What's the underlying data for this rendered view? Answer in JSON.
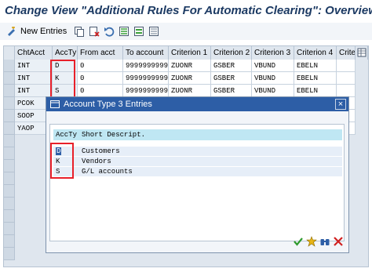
{
  "window": {
    "title": "Change View \"Additional Rules For Automatic Clearing\": Overview"
  },
  "toolbar": {
    "new_entries_label": "New Entries",
    "icons": [
      "new-entries-icon",
      "copy-icon",
      "delete-icon",
      "undo-icon",
      "select-all-icon",
      "select-block-icon",
      "deselect-all-icon"
    ]
  },
  "table": {
    "columns": [
      "ChtAcct",
      "AccTy",
      "From acct",
      "To account",
      "Criterion 1",
      "Criterion 2",
      "Criterion 3",
      "Criterion 4",
      "Crite"
    ],
    "rows": [
      {
        "chart": "INT",
        "acc_type": "D",
        "from": "0",
        "to": "9999999999",
        "c1": "ZUONR",
        "c2": "GSBER",
        "c3": "VBUND",
        "c4": "EBELN"
      },
      {
        "chart": "INT",
        "acc_type": "K",
        "from": "0",
        "to": "9999999999",
        "c1": "ZUONR",
        "c2": "GSBER",
        "c3": "VBUND",
        "c4": "EBELN"
      },
      {
        "chart": "INT",
        "acc_type": "S",
        "from": "0",
        "to": "9999999999",
        "c1": "ZUONR",
        "c2": "GSBER",
        "c3": "VBUND",
        "c4": "EBELN"
      },
      {
        "chart": "PCOK"
      },
      {
        "chart": "SOOP"
      },
      {
        "chart": "YAOP"
      }
    ]
  },
  "dialog": {
    "title": "Account Type 3 Entries",
    "close_label": "×",
    "headers": {
      "key": "AccTy",
      "desc": "Short Descript."
    },
    "items": [
      {
        "key": "D",
        "desc": "Customers"
      },
      {
        "key": "K",
        "desc": "Vendors"
      },
      {
        "key": "S",
        "desc": "G/L accounts"
      }
    ],
    "buttons": [
      "check-icon",
      "new-icon",
      "find-icon",
      "cancel-icon"
    ]
  },
  "colors": {
    "title_text": "#1c3a63",
    "dialog_title_bg": "#2d5ea6",
    "highlight_box": "#e8202a",
    "list_header_bg": "#bfe7f3"
  }
}
